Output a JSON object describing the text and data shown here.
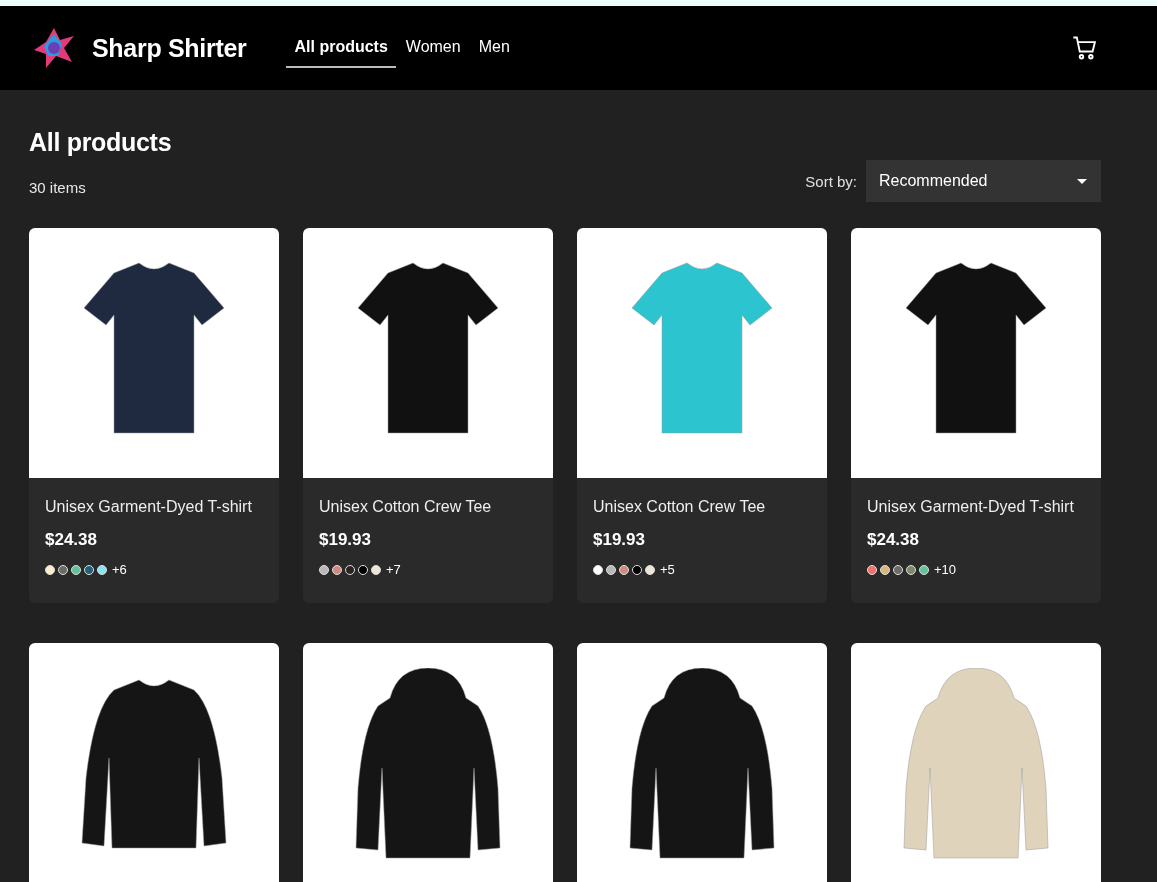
{
  "brand": {
    "name": "Sharp Shirter"
  },
  "nav": [
    {
      "label": "All products",
      "selected": true
    },
    {
      "label": "Women",
      "selected": false
    },
    {
      "label": "Men",
      "selected": false
    }
  ],
  "page": {
    "title": "All products",
    "count": "30 items",
    "sort_label": "Sort by:",
    "sort_value": "Recommended"
  },
  "products": [
    {
      "kind": "tee",
      "color": "#1f2a40",
      "name": "Unisex Garment-Dyed T-shirt",
      "price": "$24.38",
      "swatches": [
        {
          "color": "#fbeecb"
        },
        {
          "color": "#6a6a66"
        },
        {
          "color": "#63c29a"
        },
        {
          "color": "#226077"
        },
        {
          "color": "#8ce3ef"
        }
      ],
      "more": "+6"
    },
    {
      "kind": "tee",
      "color": "#111111",
      "name": "Unisex Cotton Crew Tee",
      "price": "$19.93",
      "swatches": [
        {
          "color": "#b9b9b9"
        },
        {
          "color": "#d08b80"
        },
        {
          "color": "#2c2222"
        },
        {
          "color": "#000000"
        },
        {
          "color": "#ece6d3"
        }
      ],
      "more": "+7"
    },
    {
      "kind": "tee",
      "color": "#2bc4cf",
      "name": "Unisex Cotton Crew Tee",
      "price": "$19.93",
      "swatches": [
        {
          "color": "#ffffff"
        },
        {
          "color": "#b8b8b8"
        },
        {
          "color": "#d08b80"
        },
        {
          "color": "#000000"
        },
        {
          "color": "#ece6d3"
        }
      ],
      "more": "+5"
    },
    {
      "kind": "tee",
      "color": "#111111",
      "name": "Unisex Garment-Dyed T-shirt",
      "price": "$24.38",
      "swatches": [
        {
          "color": "#f47068"
        },
        {
          "color": "#d9b67c"
        },
        {
          "color": "#6c6c66"
        },
        {
          "color": "#7d8a6a"
        },
        {
          "color": "#63c29a"
        }
      ],
      "more": "+10"
    },
    {
      "kind": "sweatshirt",
      "color": "#151515"
    },
    {
      "kind": "hoodie",
      "color": "#151515"
    },
    {
      "kind": "hoodie",
      "color": "#151515"
    },
    {
      "kind": "hoodie",
      "color": "#e0d3bb"
    }
  ]
}
